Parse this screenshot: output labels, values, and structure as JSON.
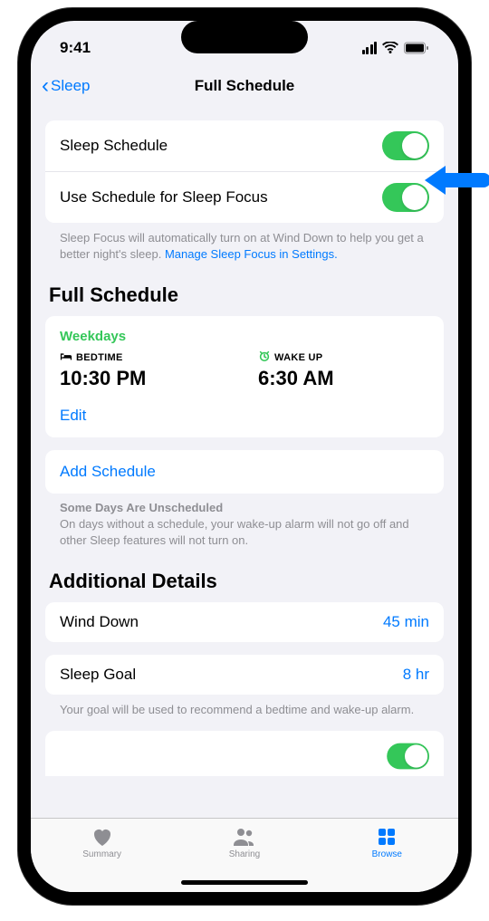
{
  "status": {
    "time": "9:41"
  },
  "nav": {
    "back": "Sleep",
    "title": "Full Schedule"
  },
  "toggles": {
    "sleep_schedule": "Sleep Schedule",
    "use_focus": "Use Schedule for Sleep Focus"
  },
  "focus_footer": "Sleep Focus will automatically turn on at Wind Down to help you get a better night's sleep. ",
  "focus_link": "Manage Sleep Focus in Settings.",
  "sections": {
    "full_schedule": "Full Schedule",
    "additional": "Additional Details"
  },
  "schedule": {
    "label": "Weekdays",
    "bedtime_label": "BEDTIME",
    "bedtime_value": "10:30 PM",
    "wakeup_label": "WAKE UP",
    "wakeup_value": "6:30 AM",
    "edit": "Edit"
  },
  "add_schedule": "Add Schedule",
  "unscheduled": {
    "title": "Some Days Are Unscheduled",
    "body": "On days without a schedule, your wake-up alarm will not go off and other Sleep features will not turn on."
  },
  "details": {
    "wind_down": {
      "label": "Wind Down",
      "value": "45 min"
    },
    "sleep_goal": {
      "label": "Sleep Goal",
      "value": "8 hr"
    },
    "goal_footer": "Your goal will be used to recommend a bedtime and wake-up alarm."
  },
  "tabs": {
    "summary": "Summary",
    "sharing": "Sharing",
    "browse": "Browse"
  }
}
